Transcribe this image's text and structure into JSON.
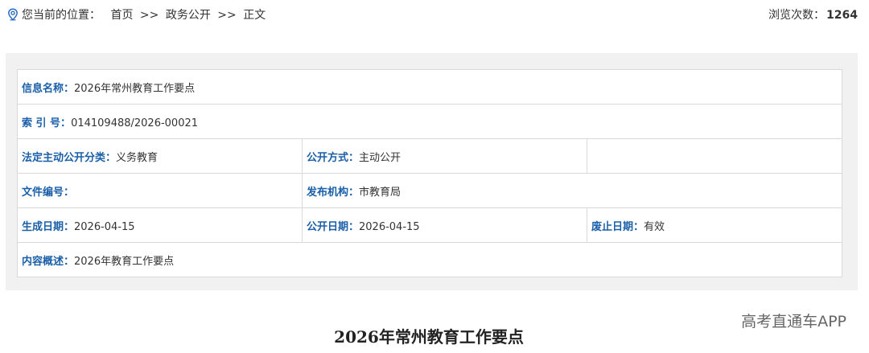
{
  "breadcrumb": {
    "label": "您当前的位置：",
    "items": [
      "首页",
      "政务公开",
      "正文"
    ],
    "separator": ">>"
  },
  "views": {
    "label": "浏览次数：",
    "count": "1264"
  },
  "info": {
    "name_label": "信息名称：",
    "name_value": "2026年常州教育工作要点",
    "index_label": "索 引 号：",
    "index_value": "014109488/2026-00021",
    "category_label": "法定主动公开分类：",
    "category_value": "义务教育",
    "mode_label": "公开方式：",
    "mode_value": "主动公开",
    "docno_label": "文件编号：",
    "docno_value": "",
    "org_label": "发布机构：",
    "org_value": "市教育局",
    "created_label": "生成日期：",
    "created_value": "2026-04-15",
    "published_label": "公开日期：",
    "published_value": "2026-04-15",
    "expiry_label": "废止日期：",
    "expiry_value": "有效",
    "summary_label": "内容概述：",
    "summary_value": "2026年教育工作要点"
  },
  "watermark": "高考直通车APP",
  "article": {
    "title": "2026年常州教育工作要点"
  },
  "colors": {
    "label_blue": "#1a5fa8",
    "panel_gray": "#f1f1f1",
    "border": "#d9d9d9"
  },
  "icons": {
    "location": "location-pin-icon"
  }
}
